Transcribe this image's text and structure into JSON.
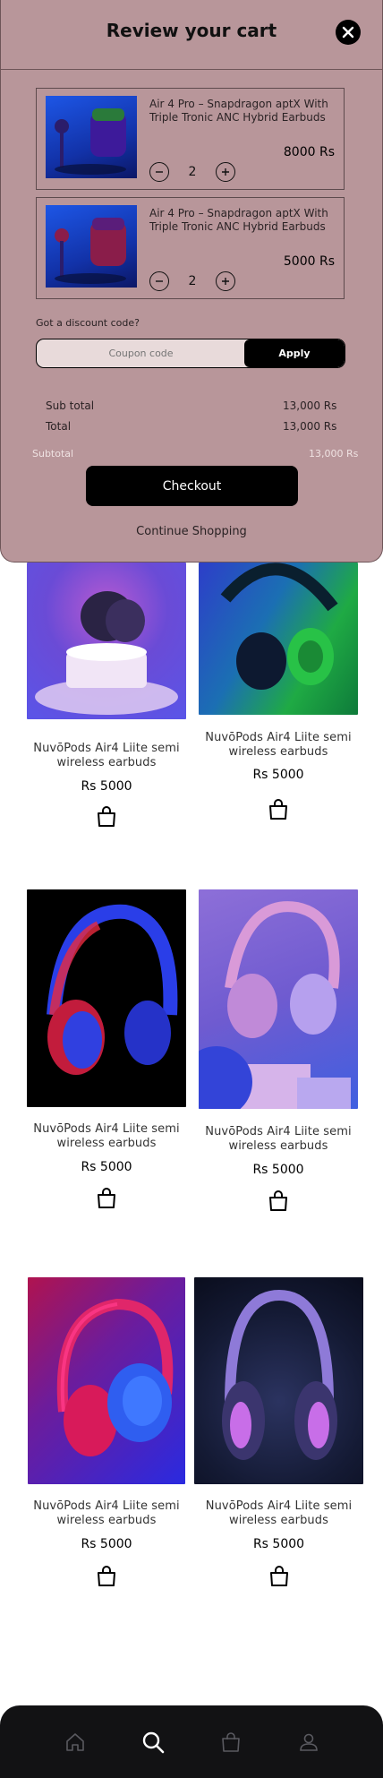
{
  "cart": {
    "title": "Review your cart",
    "items": [
      {
        "name": "Air 4 Pro  – Snapdragon aptX With Triple Tronic ANC Hybrid Earbuds",
        "quantity": "2",
        "price": "8000  Rs"
      },
      {
        "name": "Air 4 Pro  – Snapdragon aptX With Triple Tronic ANC Hybrid Earbuds",
        "quantity": "2",
        "price": "5000  Rs"
      }
    ],
    "discount_label": "Got a discount code?",
    "coupon_placeholder": "Coupon code",
    "apply_label": "Apply",
    "summary": [
      {
        "label": "Sub total",
        "value": "13,000 Rs"
      },
      {
        "label": "Total",
        "value": "13,000 Rs"
      }
    ],
    "subtotal_faint": {
      "label": "Subtotal",
      "value": "13,000 Rs"
    },
    "checkout_label": "Checkout",
    "continue_label": "Continue Shopping"
  },
  "products": [
    {
      "name": "NuvōPods Air4 Liite semi wireless earbuds",
      "price": "Rs 5000"
    },
    {
      "name": "NuvōPods Air4 Liite semi wireless earbuds",
      "price": "Rs 5000"
    },
    {
      "name": "NuvōPods Air4 Liite semi wireless earbuds",
      "price": "Rs 5000"
    },
    {
      "name": "NuvōPods Air4 Liite semi wireless earbuds",
      "price": "Rs 5000"
    },
    {
      "name": "NuvōPods Air4 Liite semi wireless earbuds",
      "price": "Rs 5000"
    },
    {
      "name": "NuvōPods Air4 Liite semi wireless earbuds",
      "price": "Rs 5000"
    }
  ],
  "nav": {
    "items": [
      {
        "icon": "home-icon",
        "active": false
      },
      {
        "icon": "search-icon",
        "active": true
      },
      {
        "icon": "bag-icon",
        "active": false
      },
      {
        "icon": "profile-icon",
        "active": false
      }
    ]
  },
  "colors": {
    "sheet_bg": "#b8969a",
    "nav_bg": "#121214",
    "button_bg": "#000000",
    "nav_active": "#ffffff",
    "nav_inactive": "#5a5a60"
  }
}
